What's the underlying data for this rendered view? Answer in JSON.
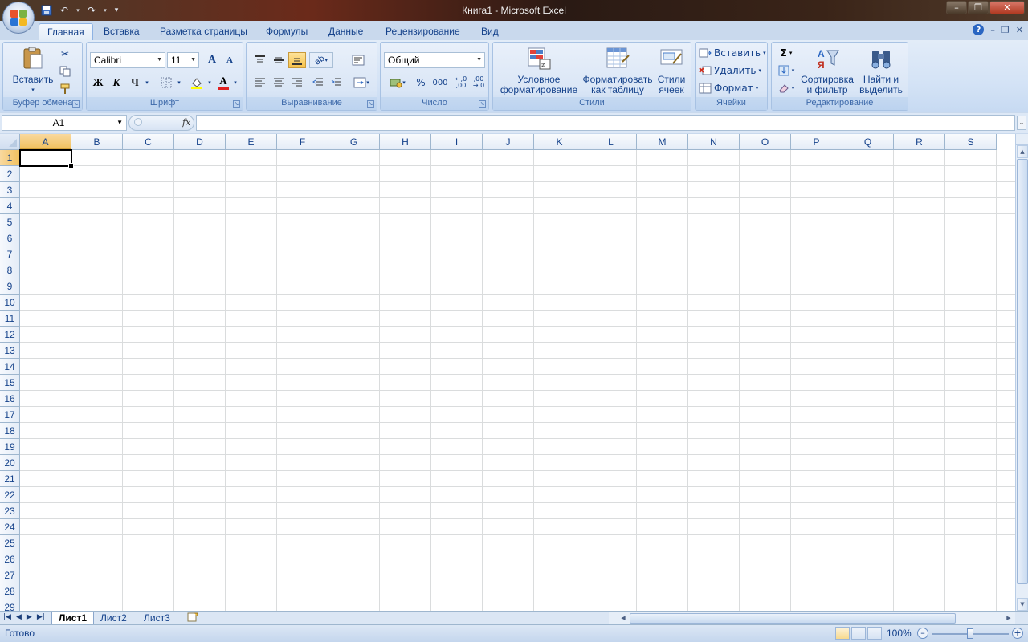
{
  "window": {
    "title": "Книга1 - Microsoft Excel"
  },
  "ribbon_tabs": [
    "Главная",
    "Вставка",
    "Разметка страницы",
    "Формулы",
    "Данные",
    "Рецензирование",
    "Вид"
  ],
  "clipboard": {
    "paste_label": "Вставить",
    "group_label": "Буфер обмена"
  },
  "font": {
    "font_name": "Calibri",
    "font_size": "11",
    "bold": "Ж",
    "italic": "К",
    "underline": "Ч",
    "grow": "A",
    "shrink": "A",
    "font_color_glyph": "A",
    "group_label": "Шрифт"
  },
  "alignment": {
    "group_label": "Выравнивание"
  },
  "number": {
    "format": "Общий",
    "percent": "%",
    "thousands": "000",
    "inc_decimal": "+,0 ,00",
    "dec_decimal": ",00 →,0",
    "group_label": "Число"
  },
  "styles": {
    "conditional": "Условное форматирование",
    "conditional_l1": "Условное",
    "conditional_l2": "форматирование",
    "as_table_l1": "Форматировать",
    "as_table_l2": "как таблицу",
    "cell_styles_l1": "Стили",
    "cell_styles_l2": "ячеек",
    "group_label": "Стили"
  },
  "cells_group": {
    "insert": "Вставить",
    "delete": "Удалить",
    "format": "Формат",
    "group_label": "Ячейки"
  },
  "editing": {
    "sum_glyph": "Σ",
    "sort_l1": "Сортировка",
    "sort_l2": "и фильтр",
    "find_l1": "Найти и",
    "find_l2": "выделить",
    "group_label": "Редактирование"
  },
  "formula_bar": {
    "name_box": "A1",
    "fx": "fx",
    "value": ""
  },
  "grid": {
    "columns": [
      "A",
      "B",
      "C",
      "D",
      "E",
      "F",
      "G",
      "H",
      "I",
      "J",
      "K",
      "L",
      "M",
      "N",
      "O",
      "P",
      "Q",
      "R",
      "S"
    ],
    "rows": [
      "1",
      "2",
      "3",
      "4",
      "5",
      "6",
      "7",
      "8",
      "9",
      "10",
      "11",
      "12",
      "13",
      "14",
      "15",
      "16",
      "17",
      "18",
      "19",
      "20",
      "21",
      "22",
      "23",
      "24",
      "25",
      "26",
      "27",
      "28",
      "29"
    ],
    "selected_col": "A",
    "selected_row": "1"
  },
  "sheets": {
    "tabs": [
      "Лист1",
      "Лист2",
      "Лист3"
    ],
    "active": "Лист1"
  },
  "status": {
    "ready": "Готово",
    "zoom": "100%"
  }
}
